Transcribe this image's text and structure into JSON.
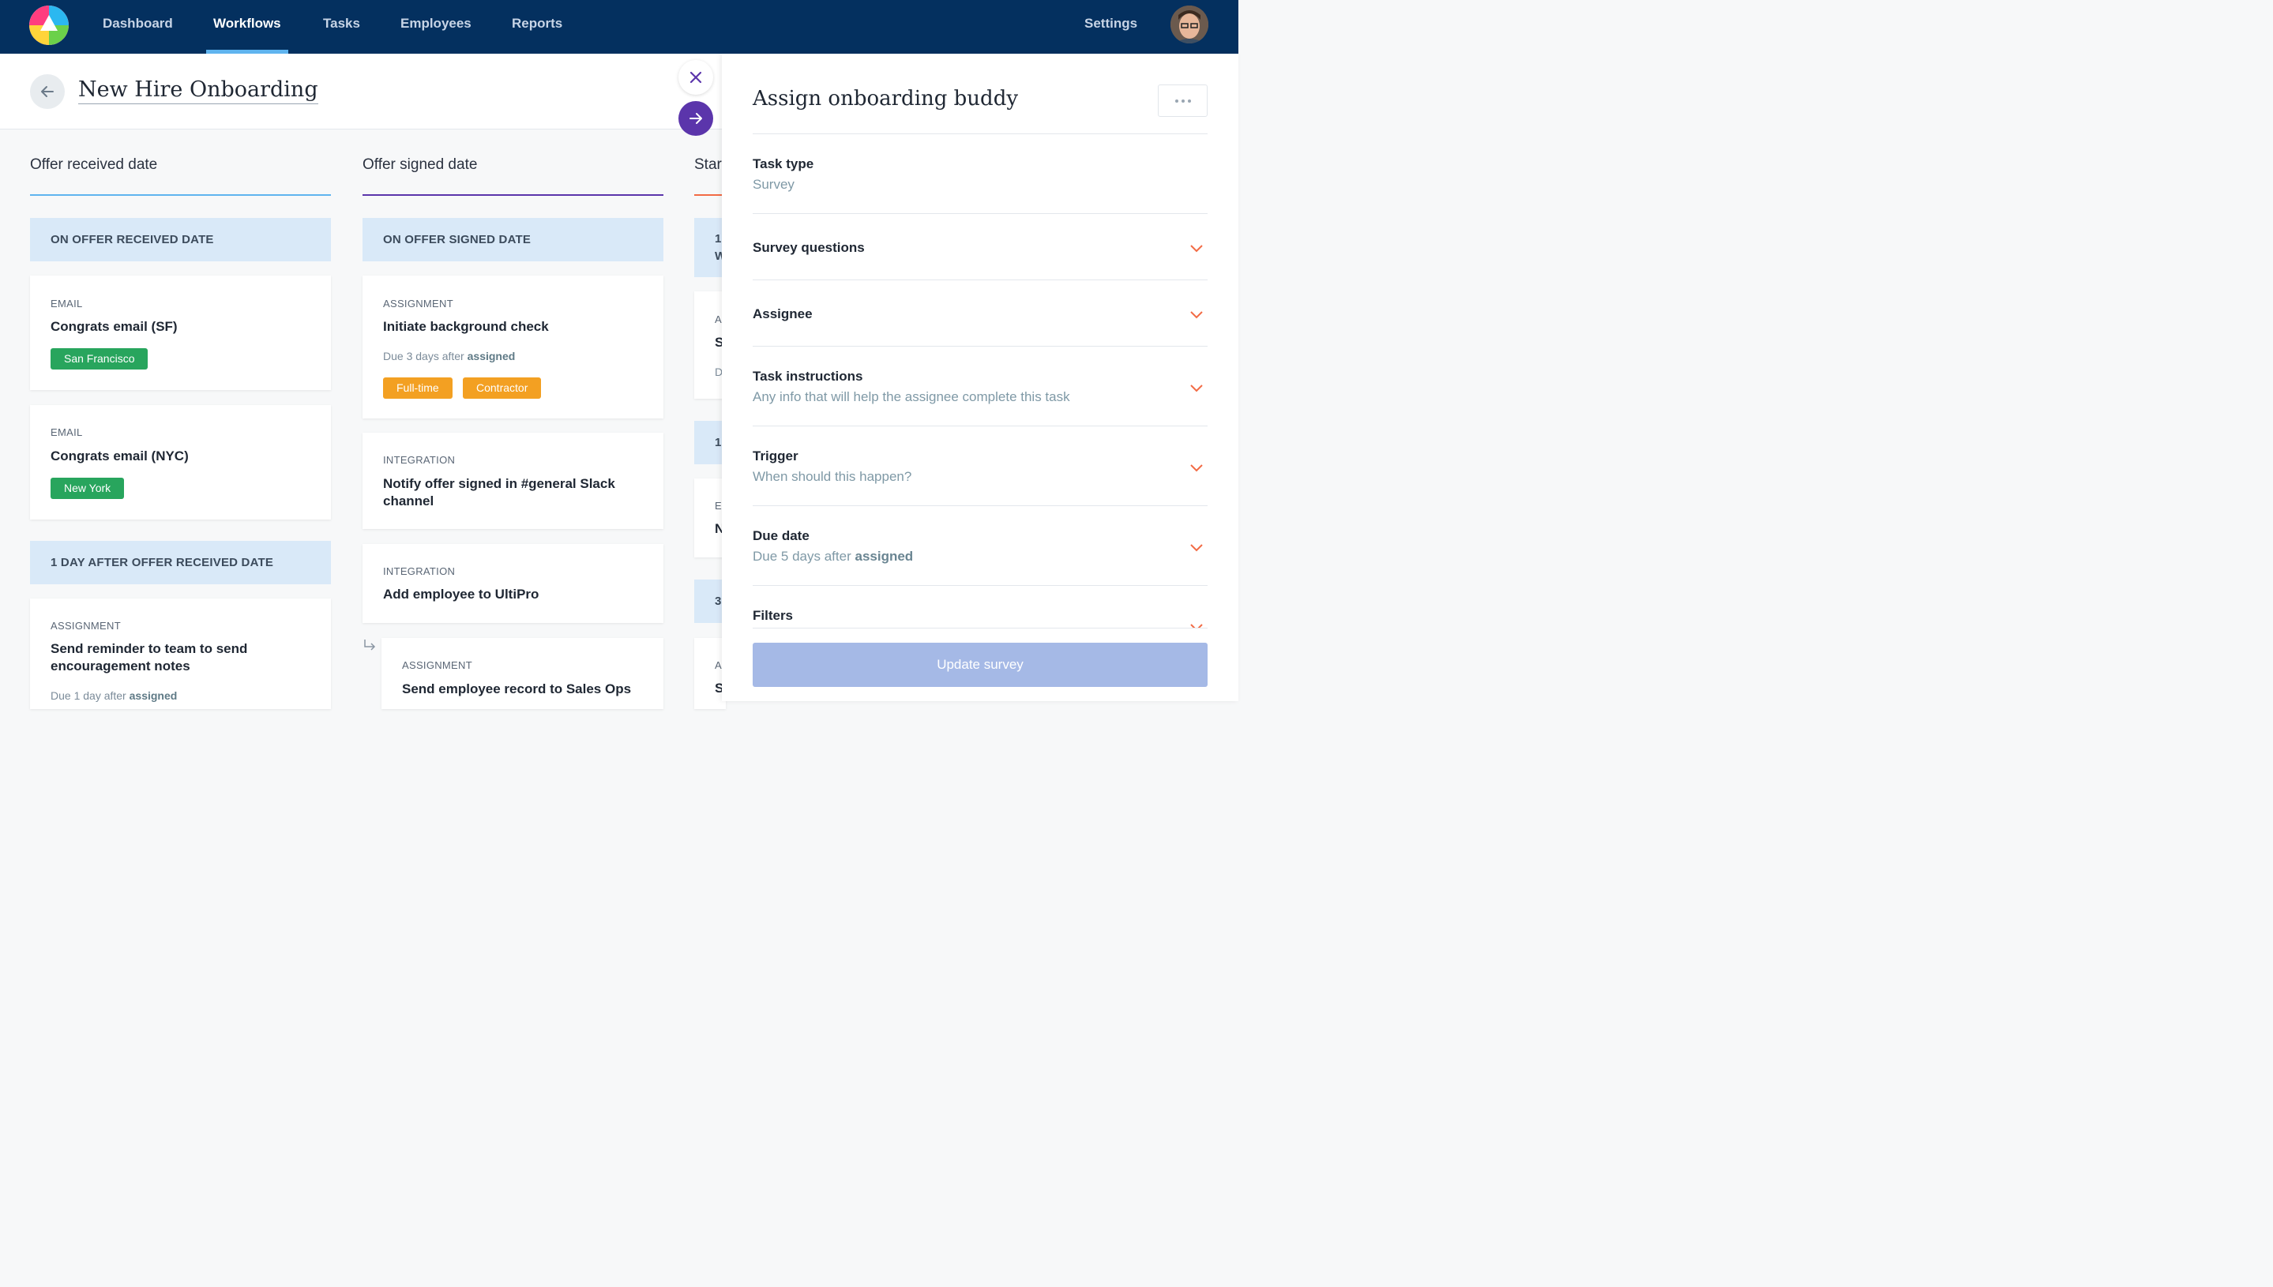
{
  "nav": {
    "items": [
      "Dashboard",
      "Workflows",
      "Tasks",
      "Employees",
      "Reports"
    ],
    "active": "Workflows",
    "settings": "Settings"
  },
  "page": {
    "title": "New Hire Onboarding"
  },
  "columns": [
    {
      "heading": "Offer received date",
      "color": "#5fb4ef"
    },
    {
      "heading": "Offer signed date",
      "color": "#5b35ab"
    },
    {
      "heading": "Star",
      "color": "#f26b45"
    }
  ],
  "col1": {
    "group1": "ON OFFER RECEIVED DATE",
    "card1": {
      "type": "EMAIL",
      "title": "Congrats email (SF)",
      "tag": "San Francisco"
    },
    "card2": {
      "type": "EMAIL",
      "title": "Congrats email (NYC)",
      "tag": "New York"
    },
    "group2": "1 DAY AFTER OFFER RECEIVED DATE",
    "card3": {
      "type": "ASSIGNMENT",
      "title": "Send reminder to team to send encouragement notes",
      "due_prefix": "Due 1 day after",
      "due_bold": "assigned"
    }
  },
  "col2": {
    "group1": "ON OFFER SIGNED DATE",
    "card1": {
      "type": "ASSIGNMENT",
      "title": "Initiate background check",
      "due_prefix": "Due 3 days after",
      "due_bold": "assigned",
      "tags": [
        "Full-time",
        "Contractor"
      ]
    },
    "card2": {
      "type": "INTEGRATION",
      "title": "Notify offer signed in #general Slack channel"
    },
    "card3": {
      "type": "INTEGRATION",
      "title": "Add employee to UltiPro"
    },
    "card4": {
      "type": "ASSIGNMENT",
      "title": "Send employee record to Sales Ops"
    }
  },
  "col3_partial": {
    "group1": [
      "1",
      "W"
    ],
    "card1": [
      "A",
      "S",
      "D"
    ],
    "group2": "1",
    "card2": [
      "E",
      "N"
    ],
    "group3": "3",
    "card3": [
      "A",
      "S"
    ]
  },
  "panel": {
    "title": "Assign onboarding buddy",
    "fields": [
      {
        "label": "Task type",
        "value": "Survey"
      },
      {
        "label": "Survey questions"
      },
      {
        "label": "Assignee"
      },
      {
        "label": "Task instructions",
        "value": "Any info that will help the assignee complete this task"
      },
      {
        "label": "Trigger",
        "value": "When should this happen?"
      },
      {
        "label": "Due date",
        "value_prefix": "Due 5 days after",
        "value_bold": "assigned"
      },
      {
        "label": "Filters"
      }
    ],
    "update_button": "Update survey"
  },
  "colors": {
    "nav_bg": "#04305f",
    "accent_purple": "#5b35ab",
    "chevron": "#f26b45",
    "tag_green": "#28a55d",
    "tag_orange": "#f3a022",
    "group_bg": "#d9e9f8"
  },
  "icons": [
    "app-logo-icon",
    "back-arrow-icon",
    "close-icon",
    "next-arrow-icon",
    "more-dots-icon",
    "chevron-down-icon",
    "sub-item-arrow-icon",
    "user-avatar"
  ]
}
